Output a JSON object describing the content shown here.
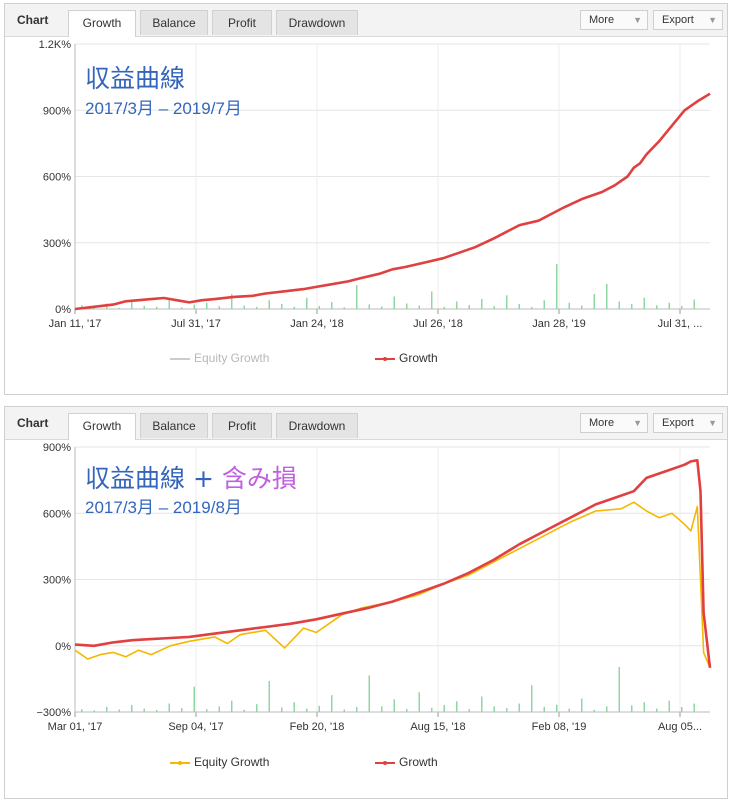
{
  "colors": {
    "growth": "#e04040",
    "equity": "#f5b800",
    "volume": "#8fd6a2",
    "equity_disabled": "#cccccc",
    "title_blue": "#3366bb",
    "title_pink": "#c060e0"
  },
  "panels": [
    {
      "header": {
        "chart_label": "Chart",
        "tabs": [
          "Growth",
          "Balance",
          "Profit",
          "Drawdown"
        ],
        "active_tab": "Growth",
        "more_label": "More",
        "export_label": "Export"
      },
      "overlay": {
        "title": "収益曲線",
        "title_suffix": "",
        "subtitle": "2017/3月 – 2019/7月"
      },
      "legend": {
        "equity": "Equity Growth",
        "growth": "Growth"
      }
    },
    {
      "header": {
        "chart_label": "Chart",
        "tabs": [
          "Growth",
          "Balance",
          "Profit",
          "Drawdown"
        ],
        "active_tab": "Growth",
        "more_label": "More",
        "export_label": "Export"
      },
      "overlay": {
        "title": "収益曲線",
        "title_plus": " + ",
        "title_suffix": "含み損",
        "subtitle": "2017/3月 – 2019/8月"
      },
      "legend": {
        "equity": "Equity Growth",
        "growth": "Growth"
      }
    }
  ],
  "chart_data": [
    {
      "type": "line",
      "x_ticks": [
        "Jan 11, '17",
        "Jul 31, '17",
        "Jan 24, '18",
        "Jul 26, '18",
        "Jan 28, '19",
        "Jul 31, ..."
      ],
      "y_ticks": [
        "0%",
        "300%",
        "600%",
        "900%",
        "1.2K%"
      ],
      "ylim": [
        0,
        1200
      ],
      "equity_enabled": false,
      "series": [
        {
          "name": "Growth",
          "x": [
            0,
            0.03,
            0.06,
            0.08,
            0.1,
            0.12,
            0.14,
            0.16,
            0.18,
            0.2,
            0.22,
            0.25,
            0.28,
            0.3,
            0.33,
            0.36,
            0.38,
            0.4,
            0.43,
            0.45,
            0.48,
            0.5,
            0.52,
            0.55,
            0.58,
            0.6,
            0.63,
            0.66,
            0.68,
            0.7,
            0.73,
            0.75,
            0.77,
            0.8,
            0.83,
            0.85,
            0.87,
            0.88,
            0.89,
            0.9,
            0.92,
            0.94,
            0.96,
            0.98,
            1.0
          ],
          "values": [
            0,
            10,
            20,
            35,
            40,
            45,
            50,
            40,
            30,
            40,
            45,
            55,
            60,
            70,
            80,
            90,
            100,
            110,
            125,
            140,
            160,
            180,
            190,
            210,
            230,
            250,
            280,
            320,
            350,
            380,
            400,
            430,
            460,
            500,
            530,
            560,
            600,
            640,
            660,
            700,
            760,
            830,
            900,
            940,
            975
          ]
        },
        {
          "name": "Equity Growth",
          "x": [],
          "values": []
        }
      ],
      "volume_bars": [
        15,
        8,
        22,
        5,
        30,
        12,
        9,
        40,
        7,
        18,
        25,
        11,
        60,
        14,
        8,
        35,
        20,
        9,
        45,
        12,
        28,
        7,
        95,
        18,
        10,
        50,
        22,
        14,
        70,
        9,
        30,
        16,
        40,
        11,
        55,
        20,
        8,
        35,
        180,
        25,
        14,
        60,
        100,
        30,
        20,
        45,
        15,
        25,
        12,
        38
      ]
    },
    {
      "type": "line",
      "x_ticks": [
        "Mar 01, '17",
        "Sep 04, '17",
        "Feb 20, '18",
        "Aug 15, '18",
        "Feb 08, '19",
        "Aug 05..."
      ],
      "y_ticks": [
        "−300%",
        "0%",
        "300%",
        "600%",
        "900%"
      ],
      "ylim": [
        -300,
        900
      ],
      "equity_enabled": true,
      "series": [
        {
          "name": "Growth",
          "x": [
            0,
            0.03,
            0.06,
            0.09,
            0.12,
            0.15,
            0.18,
            0.22,
            0.26,
            0.3,
            0.34,
            0.38,
            0.42,
            0.46,
            0.5,
            0.54,
            0.58,
            0.62,
            0.66,
            0.7,
            0.74,
            0.78,
            0.82,
            0.86,
            0.88,
            0.9,
            0.92,
            0.94,
            0.96,
            0.97,
            0.98,
            0.985,
            0.99,
            1.0
          ],
          "values": [
            5,
            0,
            15,
            25,
            30,
            35,
            40,
            55,
            70,
            85,
            100,
            120,
            145,
            170,
            200,
            240,
            280,
            330,
            390,
            460,
            520,
            580,
            640,
            680,
            700,
            760,
            780,
            800,
            820,
            835,
            840,
            700,
            150,
            -100
          ]
        },
        {
          "name": "Equity Growth",
          "x": [
            0,
            0.02,
            0.04,
            0.06,
            0.08,
            0.1,
            0.12,
            0.15,
            0.18,
            0.22,
            0.24,
            0.26,
            0.3,
            0.33,
            0.36,
            0.38,
            0.4,
            0.42,
            0.45,
            0.5,
            0.54,
            0.58,
            0.62,
            0.66,
            0.7,
            0.74,
            0.78,
            0.82,
            0.86,
            0.88,
            0.9,
            0.92,
            0.94,
            0.96,
            0.97,
            0.98,
            0.985,
            0.99,
            1.0
          ],
          "values": [
            -20,
            -60,
            -40,
            -30,
            -50,
            -20,
            -40,
            0,
            20,
            40,
            10,
            50,
            70,
            -10,
            80,
            60,
            100,
            140,
            170,
            200,
            230,
            280,
            320,
            380,
            440,
            500,
            560,
            610,
            620,
            650,
            610,
            580,
            600,
            550,
            520,
            630,
            300,
            -30,
            -100
          ]
        }
      ],
      "volume_bars": [
        10,
        6,
        18,
        9,
        25,
        12,
        7,
        30,
        14,
        90,
        10,
        20,
        40,
        8,
        28,
        110,
        16,
        35,
        12,
        22,
        60,
        9,
        18,
        130,
        20,
        45,
        11,
        70,
        15,
        25,
        38,
        10,
        55,
        20,
        14,
        30,
        95,
        18,
        26,
        12,
        48,
        8,
        20,
        160,
        24,
        35,
        12,
        40,
        18,
        30
      ]
    }
  ]
}
